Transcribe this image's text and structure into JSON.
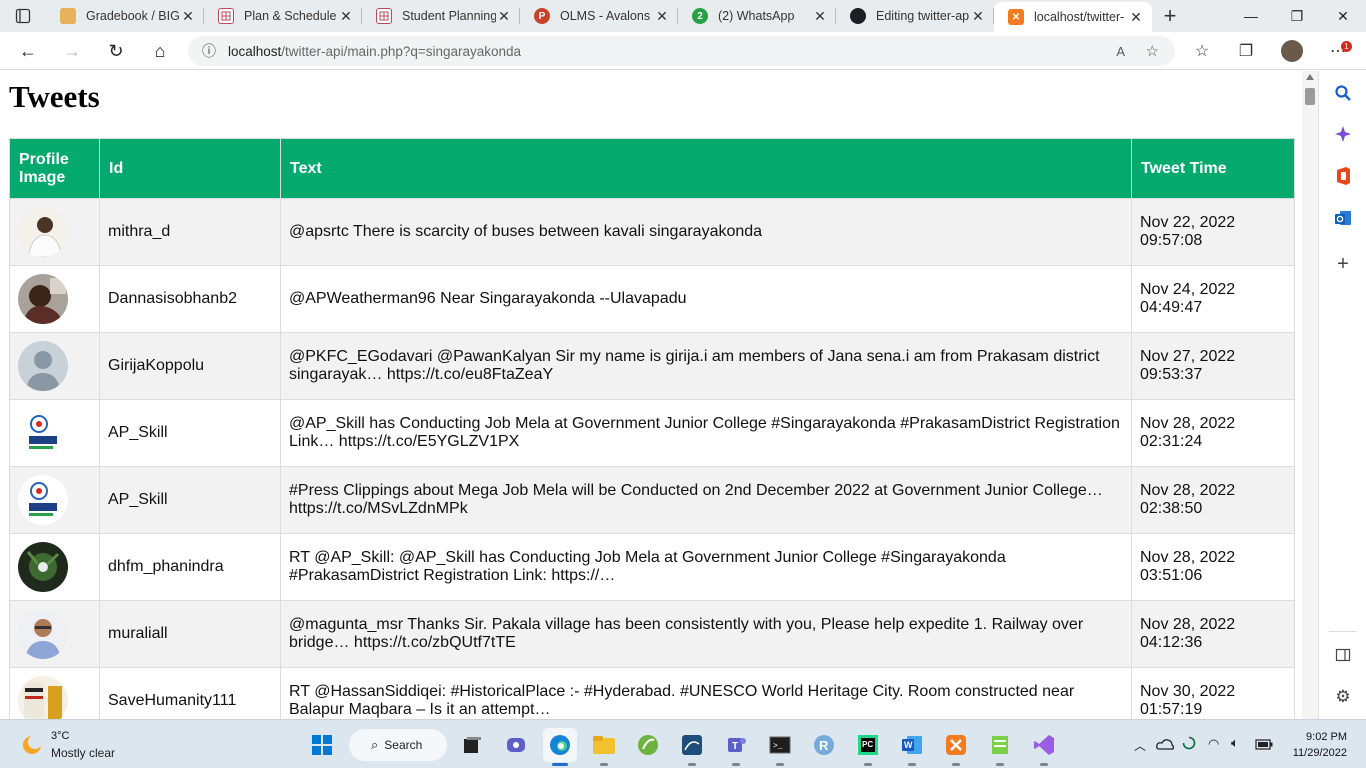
{
  "browser": {
    "tabs": [
      {
        "title": "Gradebook / BIG",
        "icon": "gradebook-icon",
        "active": false
      },
      {
        "title": "Plan & Schedule",
        "icon": "plan-schedule-icon",
        "active": false
      },
      {
        "title": "Student Planning",
        "icon": "student-planning-icon",
        "active": false
      },
      {
        "title": "OLMS - Avalons",
        "icon": "powerpoint-icon",
        "active": false
      },
      {
        "title": "(2) WhatsApp",
        "icon": "whatsapp-icon",
        "badge": "2",
        "active": false
      },
      {
        "title": "Editing twitter-ap",
        "icon": "github-icon",
        "active": false
      },
      {
        "title": "localhost/twitter-",
        "icon": "xampp-icon",
        "active": true
      }
    ],
    "url_host": "localhost",
    "url_path": "/twitter-api/main.php?q=singarayakonda",
    "notification_badge": "1"
  },
  "page": {
    "heading": "Tweets",
    "columns": [
      "Profile Image",
      "Id",
      "Text",
      "Tweet Time"
    ],
    "rows": [
      {
        "avatar": "photo-man-white-shirt",
        "id": "mithra_d",
        "text": "@apsrtc There is scarcity of buses between kavali singarayakonda",
        "date": "Nov 22, 2022",
        "time": "09:57:08"
      },
      {
        "avatar": "photo-dark-portrait",
        "id": "Dannasisobhanb2",
        "text": "@APWeatherman96 Near Singarayakonda --Ulavapadu",
        "date": "Nov 24, 2022",
        "time": "04:49:47"
      },
      {
        "avatar": "default-profile",
        "id": "GirijaKoppolu",
        "text": "@PKFC_EGodavari @PawanKalyan Sir my name is girija.i am members of Jana sena.i am from Prakasam district singarayak… https://t.co/eu8FtaZeaY",
        "date": "Nov 27, 2022",
        "time": "09:53:37"
      },
      {
        "avatar": "skill-ap-logo",
        "id": "AP_Skill",
        "text": "@AP_Skill has Conducting Job Mela at Government Junior College #Singarayakonda #PrakasamDistrict Registration Link… https://t.co/E5YGLZV1PX",
        "date": "Nov 28, 2022",
        "time": "02:31:24"
      },
      {
        "avatar": "skill-ap-logo",
        "id": "AP_Skill",
        "text": "#Press Clippings about Mega Job Mela will be Conducted on 2nd December 2022 at Government Junior College… https://t.co/MSvLZdnMPk",
        "date": "Nov 28, 2022",
        "time": "02:38:50"
      },
      {
        "avatar": "photo-plant",
        "id": "dhfm_phanindra",
        "text": "RT @AP_Skill: @AP_Skill has Conducting Job Mela at Government Junior College #Singarayakonda #PrakasamDistrict Registration Link: https://…",
        "date": "Nov 28, 2022",
        "time": "03:51:06"
      },
      {
        "avatar": "photo-elderly-man",
        "id": "muraliall",
        "text": "@magunta_msr Thanks Sir. Pakala village has been consistently with you, Please help expedite 1. Railway over bridge… https://t.co/zbQUtf7tTE",
        "date": "Nov 28, 2022",
        "time": "04:12:36"
      },
      {
        "avatar": "rss-poster",
        "id": "SaveHumanity111",
        "text": "RT @HassanSiddiqei: #HistoricalPlace :- #Hyderabad. #UNESCO World Heritage City. Room constructed near Balapur Maqbara – Is it an attempt…",
        "date": "Nov 30, 2022",
        "time": "01:57:19"
      }
    ]
  },
  "taskbar": {
    "weather_temp": "3°C",
    "weather_desc": "Mostly clear",
    "search_label": "Search",
    "clock_time": "9:02 PM",
    "clock_date": "11/29/2022"
  },
  "colors": {
    "table_header": "#04aa6d",
    "row_stripe": "#f2f2f2",
    "tabbar_bg": "#e9ecef",
    "taskbar_bg": "#dce6ef"
  }
}
